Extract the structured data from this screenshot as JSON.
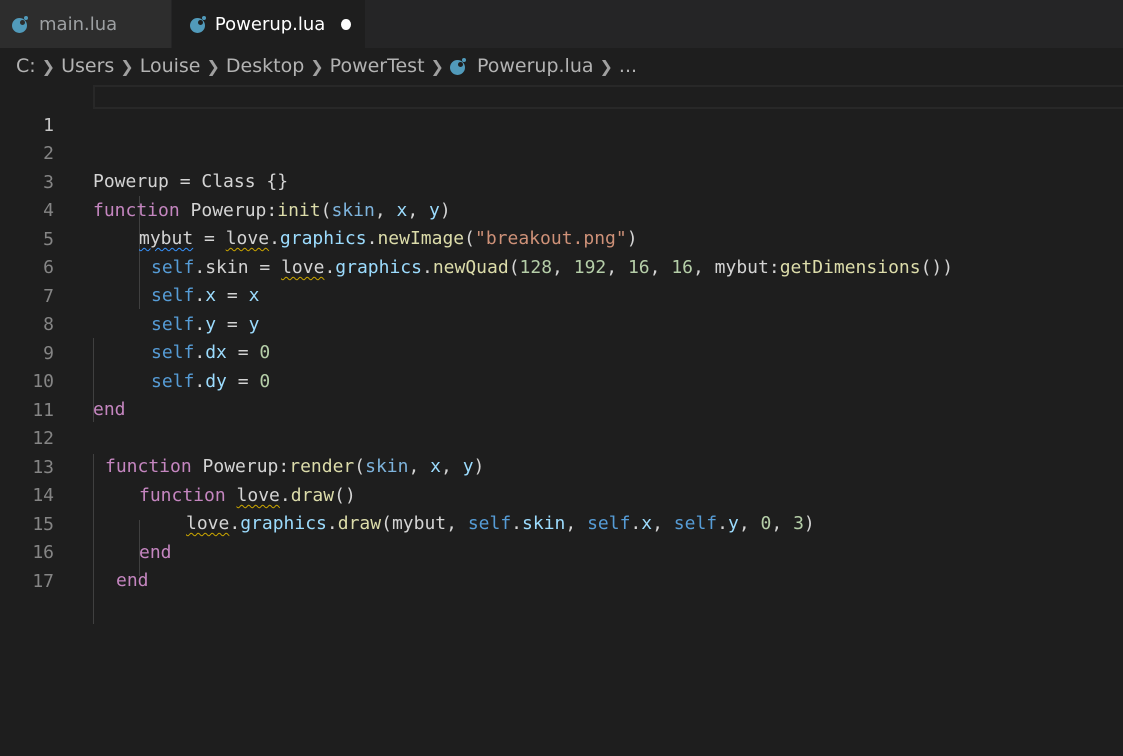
{
  "tabs": [
    {
      "label": "main.lua",
      "active": false,
      "modified": false
    },
    {
      "label": "Powerup.lua",
      "active": true,
      "modified": true
    }
  ],
  "breadcrumb": [
    "C:",
    "Users",
    "Louise",
    "Desktop",
    "PowerTest",
    "Powerup.lua",
    "..."
  ],
  "line_numbers": [
    "1",
    "2",
    "3",
    "4",
    "5",
    "6",
    "7",
    "8",
    "9",
    "10",
    "11",
    "12",
    "13",
    "14",
    "15",
    "16",
    "17"
  ],
  "code": {
    "l2": [
      "Powerup = Class {}"
    ],
    "l3": [
      "function",
      " Powerup:",
      "init",
      "(",
      "skin",
      ", ",
      "x",
      ", ",
      "y",
      ")"
    ],
    "l4": [
      "mybut",
      " = ",
      "love",
      ".",
      "graphics",
      ".",
      "newImage",
      "(",
      "\"breakout.png\"",
      ")"
    ],
    "l5": [
      "self",
      ".",
      "skin",
      " = ",
      "love",
      ".",
      "graphics",
      ".",
      "newQuad",
      "(",
      "128",
      ", ",
      "192",
      ", ",
      "16",
      ", ",
      "16",
      ", mybut:",
      "getDimensions",
      "())"
    ],
    "l6": [
      "self",
      ".",
      "x",
      " = ",
      "x"
    ],
    "l7": [
      "self",
      ".",
      "y",
      " = ",
      "y"
    ],
    "l8": [
      "self",
      ".",
      "dx",
      " = ",
      "0"
    ],
    "l9": [
      "self",
      ".",
      "dy",
      " = ",
      "0"
    ],
    "l10": [
      "end"
    ],
    "l12": [
      "function",
      " Powerup:",
      "render",
      "(",
      "skin",
      ", ",
      "x",
      ", ",
      "y",
      ")"
    ],
    "l13": [
      "function",
      " ",
      "love",
      ".",
      "draw",
      "()"
    ],
    "l14": [
      "love",
      ".",
      "graphics",
      ".",
      "draw",
      "(mybut, ",
      "self",
      ".",
      "skin",
      ", ",
      "self",
      ".",
      "x",
      ", ",
      "self",
      ".",
      "y",
      ", ",
      "0",
      ", ",
      "3",
      ")"
    ],
    "l15": [
      "end"
    ],
    "l16": [
      "end"
    ]
  },
  "colors": {
    "keyword": "#c586c0",
    "function": "#dcdcaa",
    "variable": "#9cdcfe",
    "self": "#569cd6",
    "string": "#ce9178",
    "number": "#b5cea8",
    "background": "#1e1e1e"
  },
  "icons": [
    "lua-file-icon",
    "chevron-right-icon",
    "modified-dot-icon"
  ]
}
